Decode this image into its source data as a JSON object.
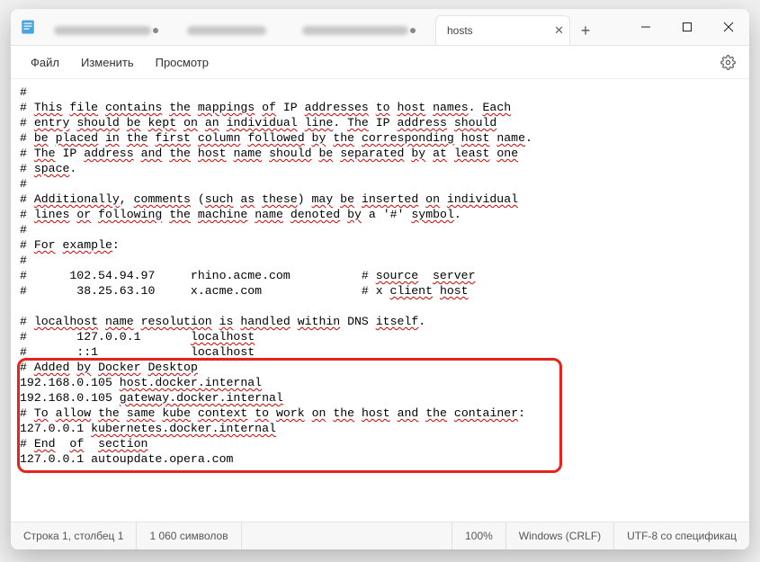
{
  "tabs": {
    "active_label": "hosts"
  },
  "menu": {
    "file": "Файл",
    "edit": "Изменить",
    "view": "Просмотр"
  },
  "content": {
    "l1": "#",
    "l2a": "# ",
    "l2b": "This",
    "l2c": " ",
    "l2d": "file",
    "l2e": " ",
    "l2f": "contains",
    "l2g": " ",
    "l2h": "the",
    "l2i": " ",
    "l2j": "mappings",
    "l2k": " ",
    "l2l": "of",
    "l2m": " IP ",
    "l2n": "addresses",
    "l2o": " ",
    "l2p": "to",
    "l2q": " ",
    "l2r": "host",
    "l2s": " ",
    "l2t": "names",
    "l2u": ". ",
    "l2v": "Each",
    "l3a": "# ",
    "l3b": "entry",
    "l3c": " ",
    "l3d": "should",
    "l3e": " ",
    "l3f": "be",
    "l3g": " ",
    "l3h": "kept",
    "l3i": " ",
    "l3j": "on",
    "l3k": " ",
    "l3l": "an",
    "l3m": " ",
    "l3n": "individual",
    "l3o": " ",
    "l3p": "line",
    "l3q": ". ",
    "l3r": "The",
    "l3s": " IP ",
    "l3t": "address",
    "l3u": " ",
    "l3v": "should",
    "l4a": "# ",
    "l4b": "be",
    "l4c": " ",
    "l4d": "placed",
    "l4e": " ",
    "l4f": "in",
    "l4g": " ",
    "l4h": "the",
    "l4i": " ",
    "l4j": "first",
    "l4k": " ",
    "l4l": "column",
    "l4m": " ",
    "l4n": "followed",
    "l4o": " ",
    "l4p": "by",
    "l4q": " ",
    "l4r": "the",
    "l4s": " ",
    "l4t": "corresponding",
    "l4u": " ",
    "l4v": "host",
    "l4w": " ",
    "l4x": "name",
    "l4y": ".",
    "l5a": "# ",
    "l5b": "The",
    "l5c": " IP ",
    "l5d": "address",
    "l5e": " ",
    "l5f": "and",
    "l5g": " ",
    "l5h": "the",
    "l5i": " ",
    "l5j": "host",
    "l5k": " ",
    "l5l": "name",
    "l5m": " ",
    "l5n": "should",
    "l5o": " ",
    "l5p": "be",
    "l5q": " ",
    "l5r": "separated",
    "l5s": " ",
    "l5t": "by",
    "l5u": " ",
    "l5v": "at",
    "l5w": " ",
    "l5x": "least",
    "l5y": " ",
    "l5z": "one",
    "l6a": "# ",
    "l6b": "space",
    "l6c": ".",
    "l7": "#",
    "l8a": "# ",
    "l8b": "Additionally",
    "l8c": ", ",
    "l8d": "comments",
    "l8e": " (",
    "l8f": "such",
    "l8g": " ",
    "l8h": "as",
    "l8i": " ",
    "l8j": "these",
    "l8k": ") ",
    "l8l": "may",
    "l8m": " ",
    "l8n": "be",
    "l8o": " ",
    "l8p": "inserted",
    "l8q": " ",
    "l8r": "on",
    "l8s": " ",
    "l8t": "individual",
    "l9a": "# ",
    "l9b": "lines",
    "l9c": " ",
    "l9d": "or",
    "l9e": " ",
    "l9f": "following",
    "l9g": " ",
    "l9h": "the",
    "l9i": " ",
    "l9j": "machine",
    "l9k": " ",
    "l9l": "name",
    "l9m": " ",
    "l9n": "denoted",
    "l9o": " ",
    "l9p": "by",
    "l9q": " a '#' ",
    "l9r": "symbol",
    "l9s": ".",
    "l10": "#",
    "l11a": "# ",
    "l11b": "For",
    "l11c": " ",
    "l11d": "example",
    "l11e": ":",
    "l12": "#",
    "l13a": "#      102.54.94.97     rhino.acme.com          # ",
    "l13b": "source",
    "l13c": "  ",
    "l13d": "server",
    "l14a": "#       38.25.63.10     x.acme.com              # x ",
    "l14b": "client",
    "l14c": " ",
    "l14d": "host",
    "l15": "",
    "l16a": "# ",
    "l16b": "localhost",
    "l16c": " ",
    "l16d": "name",
    "l16e": " ",
    "l16f": "resolution",
    "l16g": " ",
    "l16h": "is",
    "l16i": " ",
    "l16j": "handled",
    "l16k": " ",
    "l16l": "within",
    "l16m": " DNS ",
    "l16n": "itself",
    "l16o": ".",
    "l17a": "#       127.0.0.1       ",
    "l17b": "localhost",
    "l18a": "#       ::1             ",
    "l18b": "localhost",
    "l19a": "# ",
    "l19b": "Added",
    "l19c": " ",
    "l19d": "by",
    "l19e": " ",
    "l19f": "Docker",
    "l19g": " ",
    "l19h": "Desktop",
    "l20a": "192.168.0.105 ",
    "l20b": "host.docker.internal",
    "l21a": "192.168.0.105 ",
    "l21b": "gateway.docker.internal",
    "l22a": "# ",
    "l22b": "To",
    "l22c": " ",
    "l22d": "allow",
    "l22e": " ",
    "l22f": "the",
    "l22g": " ",
    "l22h": "same",
    "l22i": " ",
    "l22j": "kube",
    "l22k": " ",
    "l22l": "context",
    "l22m": " ",
    "l22n": "to",
    "l22o": " ",
    "l22p": "work",
    "l22q": " ",
    "l22r": "on",
    "l22s": " ",
    "l22t": "the",
    "l22u": " ",
    "l22v": "host",
    "l22w": " ",
    "l22x": "and",
    "l22y": " ",
    "l22z": "the",
    "l22aa": " ",
    "l22ab": "container",
    "l22ac": ":",
    "l23a": "127.0.0.1 ",
    "l23b": "kubernetes.docker.internal",
    "l24a": "# ",
    "l24b": "End",
    "l24c": "  ",
    "l24d": "of",
    "l24e": "  ",
    "l24f": "section",
    "l25": "127.0.0.1 autoupdate.opera.com"
  },
  "status": {
    "pos": "Строка 1, столбец 1",
    "chars": "1 060 символов",
    "zoom": "100%",
    "eol": "Windows (CRLF)",
    "enc": "UTF-8 со спецификац"
  }
}
